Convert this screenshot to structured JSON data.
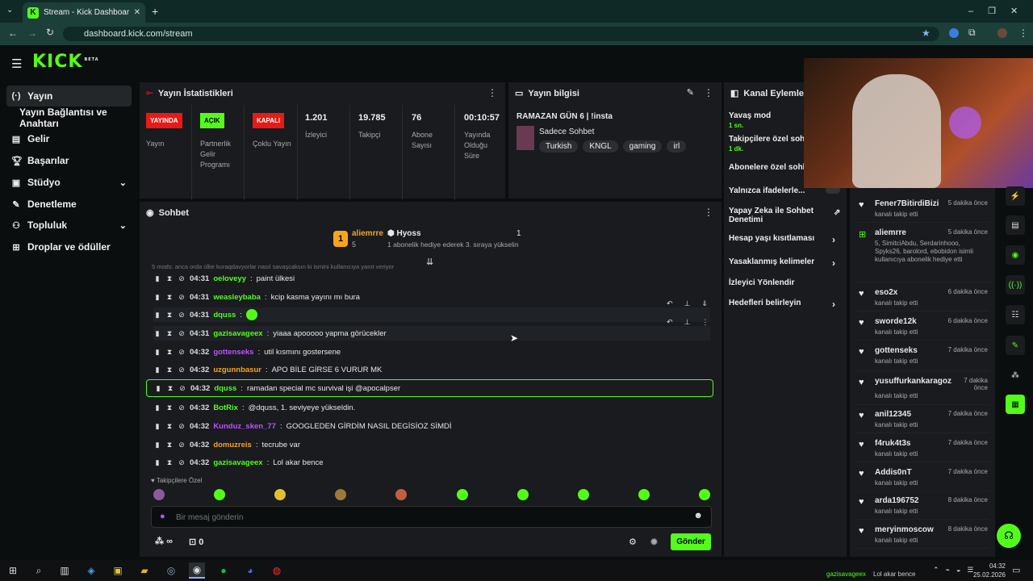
{
  "browser": {
    "tab_title": "Stream - Kick Dashboard",
    "url": "dashboard.kick.com/stream"
  },
  "header": {
    "logo": "KICK",
    "beta": "BETA"
  },
  "sidebar": {
    "items": [
      {
        "label": "Yayın",
        "icon": "broadcast-icon"
      },
      {
        "label": "Yayın Bağlantısı ve Anahtarı",
        "icon": ""
      },
      {
        "label": "Gelir",
        "icon": "money-icon"
      },
      {
        "label": "Başarılar",
        "icon": "trophy-icon"
      },
      {
        "label": "Stüdyo",
        "icon": "studio-icon"
      },
      {
        "label": "Denetleme",
        "icon": "wrench-icon"
      },
      {
        "label": "Topluluk",
        "icon": "community-icon"
      },
      {
        "label": "Droplar ve ödüller",
        "icon": "drops-icon"
      }
    ]
  },
  "stats": {
    "title": "Yayın İstatistikleri",
    "items": [
      {
        "badge": "YAYINDA",
        "label": "Yayın",
        "color": "#e91916"
      },
      {
        "badge": "AÇIK",
        "label": "Partnerlik Gelir Programı",
        "color": "#53fc18"
      },
      {
        "badge": "KAPALI",
        "label": "Çoklu Yayın",
        "color": "#e91916"
      },
      {
        "value": "1.201",
        "label": "İzleyici"
      },
      {
        "value": "19.785",
        "label": "Takipçi"
      },
      {
        "value": "76",
        "label": "Abone Sayısı"
      },
      {
        "value": "00:10:57",
        "label": "Yayında Olduğu Süre"
      }
    ]
  },
  "info": {
    "title": "Yayın bilgisi",
    "stream_title": "RAMAZAN GÜN 6 | !insta",
    "category": "Sadece Sohbet",
    "tags": [
      "Turkish",
      "KNGL",
      "gaming",
      "irl"
    ]
  },
  "actions": {
    "title": "Kanal Eylemleri",
    "items": [
      {
        "label": "Yavaş mod",
        "sub": "1 sn."
      },
      {
        "label": "Takipçilere özel sohbet",
        "sub": "1 dk."
      },
      {
        "label": "Abonelere özel sohbet",
        "sub": ""
      },
      {
        "label": "Yalnızca ifadelerle...",
        "sub": ""
      },
      {
        "label": "Yapay Zeka ile Sohbet Denetimi",
        "sub": ""
      },
      {
        "label": "Hesap yaşı kısıtlaması",
        "sub": ""
      },
      {
        "label": "Yasaklanmış kelimeler",
        "sub": ""
      },
      {
        "label": "İzleyici Yönlendir",
        "sub": ""
      },
      {
        "label": "Hedefleri belirleyin",
        "sub": ""
      }
    ]
  },
  "chat": {
    "title": "Sohbet",
    "leader1": {
      "rank": "1",
      "name": "aliemrre",
      "count": "5"
    },
    "leader2": {
      "name": "Hyoss",
      "count": "1",
      "note": "1 abonelik hediye ederek 3. sıraya yükselin"
    },
    "faded": "5 mods: anca orda ülke kuraqdavyorlar nasıl savaşcaksın ki ismini kullanıcıya yanıt veriyor",
    "messages": [
      {
        "time": "04:31",
        "user": "oeloveyy",
        "color": "#53fc18",
        "text": "paint ülkesi"
      },
      {
        "time": "04:31",
        "user": "weasleybaba",
        "color": "#53fc18",
        "text": "kcip kasma yayını mı bura"
      },
      {
        "time": "04:31",
        "user": "dquss",
        "color": "#53fc18",
        "text": ""
      },
      {
        "time": "04:31",
        "user": "gazisavageex",
        "color": "#53fc18",
        "text": "yiaaa apooooo yapma görücekler"
      },
      {
        "time": "04:32",
        "user": "gottenseks",
        "color": "#bd53ff",
        "text": "util kısmını gostersene"
      },
      {
        "time": "04:32",
        "user": "uzgunnbasur",
        "color": "#f7a41d",
        "text": "APO BİLE GİRSE 6 VURUR MK"
      },
      {
        "time": "04:32",
        "user": "dquss",
        "color": "#53fc18",
        "text": "ramadan special mc survival işi @apocalpser"
      },
      {
        "time": "04:32",
        "user": "BotRix",
        "color": "#53fc18",
        "text": "@dquss, 1. seviyeye yükseldin."
      },
      {
        "time": "04:32",
        "user": "Kunduz_sken_77",
        "color": "#bd53ff",
        "text": "GOOGLEDEN GİRDİM NASIL DEGİSİOZ SİMDİ"
      },
      {
        "time": "04:32",
        "user": "domuzreis",
        "color": "#f7a41d",
        "text": "tecrube var"
      },
      {
        "time": "04:32",
        "user": "gazisavageex",
        "color": "#53fc18",
        "text": "Lol akar bence"
      }
    ],
    "emote_label": "Takipçilere Özel",
    "input_placeholder": "Bir mesaj gönderin",
    "points": "∞",
    "gift_count": "0",
    "send": "Gönder"
  },
  "events": [
    {
      "name": "Fener7BitirdiBizi",
      "time": "5 dakika önce",
      "action": "kanalı takip etti"
    },
    {
      "name": "aliemrre",
      "time": "5 dakika önce",
      "action": "5, SimitciAbdu, Serdarinhooo, Spyks26, barolord, ebobidon isimli kullanıcıya abonelik hediye etti"
    },
    {
      "name": "eso2x",
      "time": "6 dakika önce",
      "action": "kanalı takip etti"
    },
    {
      "name": "sworde12k",
      "time": "6 dakika önce",
      "action": "kanalı takip etti"
    },
    {
      "name": "gottenseks",
      "time": "7 dakika önce",
      "action": "kanalı takip etti"
    },
    {
      "name": "yusuffurkankaragoz",
      "time": "7 dakika önce",
      "action": "kanalı takip etti"
    },
    {
      "name": "anil12345",
      "time": "7 dakika önce",
      "action": "kanalı takip etti"
    },
    {
      "name": "f4ruk4t3s",
      "time": "7 dakika önce",
      "action": "kanalı takip etti"
    },
    {
      "name": "Addis0nT",
      "time": "7 dakika önce",
      "action": "kanalı takip etti"
    },
    {
      "name": "arda196752",
      "time": "8 dakika önce",
      "action": "kanalı takip etti"
    },
    {
      "name": "meryinmoscow",
      "time": "8 dakika önce",
      "action": "kanalı takip etti"
    }
  ],
  "taskbar": {
    "time": "04:32",
    "date": "25.02.2026",
    "notif_user": "gazisavageex",
    "notif_text": "Lol akar bence"
  }
}
